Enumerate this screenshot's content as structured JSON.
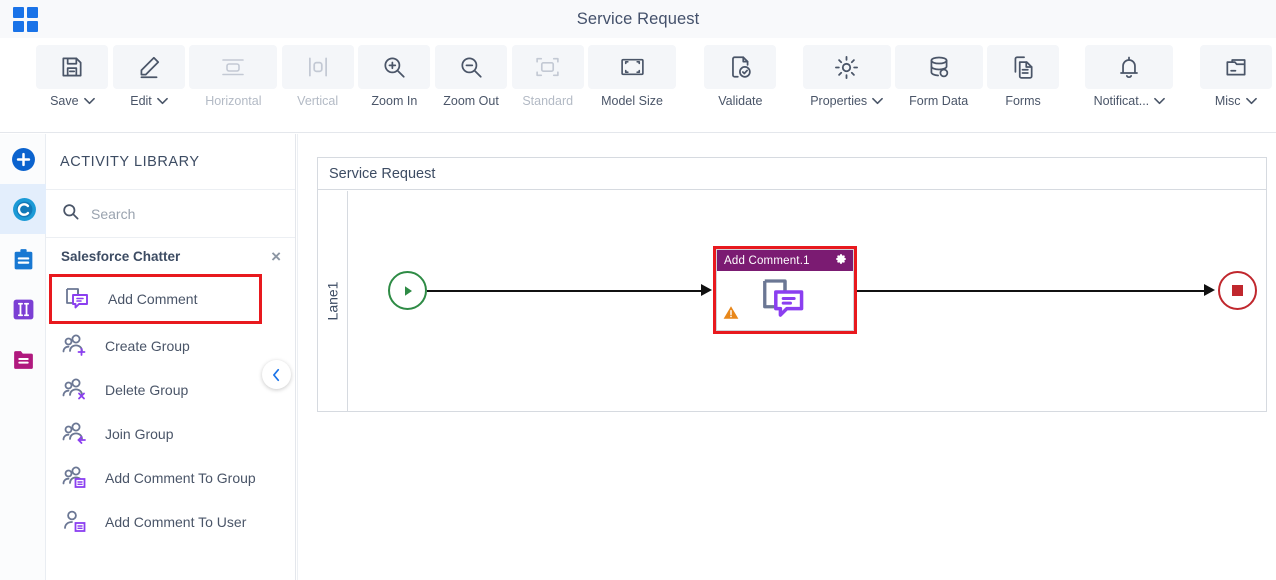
{
  "window": {
    "title": "Service Request",
    "apps_icon": "grid-apps-icon"
  },
  "toolbar": {
    "items": [
      {
        "label": "Save",
        "icon": "save-icon",
        "has_caret": true,
        "disabled": false
      },
      {
        "label": "Edit",
        "icon": "edit-pencil-icon",
        "has_caret": true,
        "disabled": false
      },
      {
        "label": "Horizontal",
        "icon": "horizontal-layout-icon",
        "has_caret": false,
        "disabled": true
      },
      {
        "label": "Vertical",
        "icon": "vertical-layout-icon",
        "has_caret": false,
        "disabled": true
      },
      {
        "label": "Zoom In",
        "icon": "zoom-in-icon",
        "has_caret": false,
        "disabled": false
      },
      {
        "label": "Zoom Out",
        "icon": "zoom-out-icon",
        "has_caret": false,
        "disabled": false
      },
      {
        "label": "Standard",
        "icon": "standard-size-icon",
        "has_caret": false,
        "disabled": true
      },
      {
        "label": "Model Size",
        "icon": "model-size-icon",
        "has_caret": false,
        "disabled": false
      },
      {
        "label": "Validate",
        "icon": "validate-check-icon",
        "has_caret": false,
        "disabled": false
      },
      {
        "label": "Properties",
        "icon": "gear-icon",
        "has_caret": true,
        "disabled": false
      },
      {
        "label": "Form Data",
        "icon": "database-icon",
        "has_caret": false,
        "disabled": false
      },
      {
        "label": "Forms",
        "icon": "forms-copy-icon",
        "has_caret": false,
        "disabled": false
      },
      {
        "label": "Notificat...",
        "icon": "bell-icon",
        "has_caret": true,
        "disabled": false
      },
      {
        "label": "Misc",
        "icon": "folder-misc-icon",
        "has_caret": true,
        "disabled": false
      }
    ],
    "caret_glyph": "⌄"
  },
  "rail": {
    "items": [
      {
        "name": "add-new-icon",
        "color": "#0b63ce",
        "active": false
      },
      {
        "name": "chatter-cloud-icon",
        "color": "#1c9ad6",
        "active": true
      },
      {
        "name": "clipboard-icon",
        "color": "#1878d2",
        "active": false
      },
      {
        "name": "columns-icon",
        "color": "#7b3fd4",
        "active": false
      },
      {
        "name": "folder-icon",
        "color": "#b0197e",
        "active": false
      }
    ]
  },
  "panel": {
    "heading": "ACTIVITY LIBRARY",
    "search": {
      "placeholder": "Search",
      "value": "",
      "icon": "search-icon"
    },
    "group": {
      "title": "Salesforce Chatter",
      "close_icon": "close-icon",
      "close_glyph": "×"
    },
    "activities": [
      {
        "label": "Add Comment",
        "icon": "add-comment-icon",
        "selected": true
      },
      {
        "label": "Create Group",
        "icon": "create-group-icon",
        "selected": false
      },
      {
        "label": "Delete Group",
        "icon": "delete-group-icon",
        "selected": false
      },
      {
        "label": "Join Group",
        "icon": "join-group-icon",
        "selected": false
      },
      {
        "label": "Add Comment To Group",
        "icon": "add-comment-to-group-icon",
        "selected": false
      },
      {
        "label": "Add Comment To User",
        "icon": "add-comment-to-user-icon",
        "selected": false
      }
    ],
    "collapse_button": {
      "icon": "chevron-left-icon",
      "glyph": "‹"
    }
  },
  "canvas": {
    "pool_title": "Service Request",
    "lane_label": "Lane1",
    "start_event": {
      "name": "start-event",
      "icon": "play-triangle-icon",
      "color": "#2e8b45"
    },
    "end_event": {
      "name": "end-event",
      "icon": "stop-square-icon",
      "color": "#c0272d"
    },
    "task": {
      "title": "Add Comment.1",
      "header_color": "#7b1b72",
      "gear_icon": "gear-icon",
      "glyph_icon": "add-comment-icon",
      "warning_icon": "warning-triangle-icon",
      "selection_color": "#e8191e"
    },
    "flows": [
      {
        "name": "sequence-flow-start-to-task"
      },
      {
        "name": "sequence-flow-task-to-end"
      }
    ]
  },
  "colors": {
    "accent_blue": "#1a73e8",
    "selection_red": "#e8191e",
    "task_purple": "#7b1b72",
    "start_green": "#2e8b45",
    "end_red": "#c0272d",
    "warning_orange": "#e8871a"
  }
}
